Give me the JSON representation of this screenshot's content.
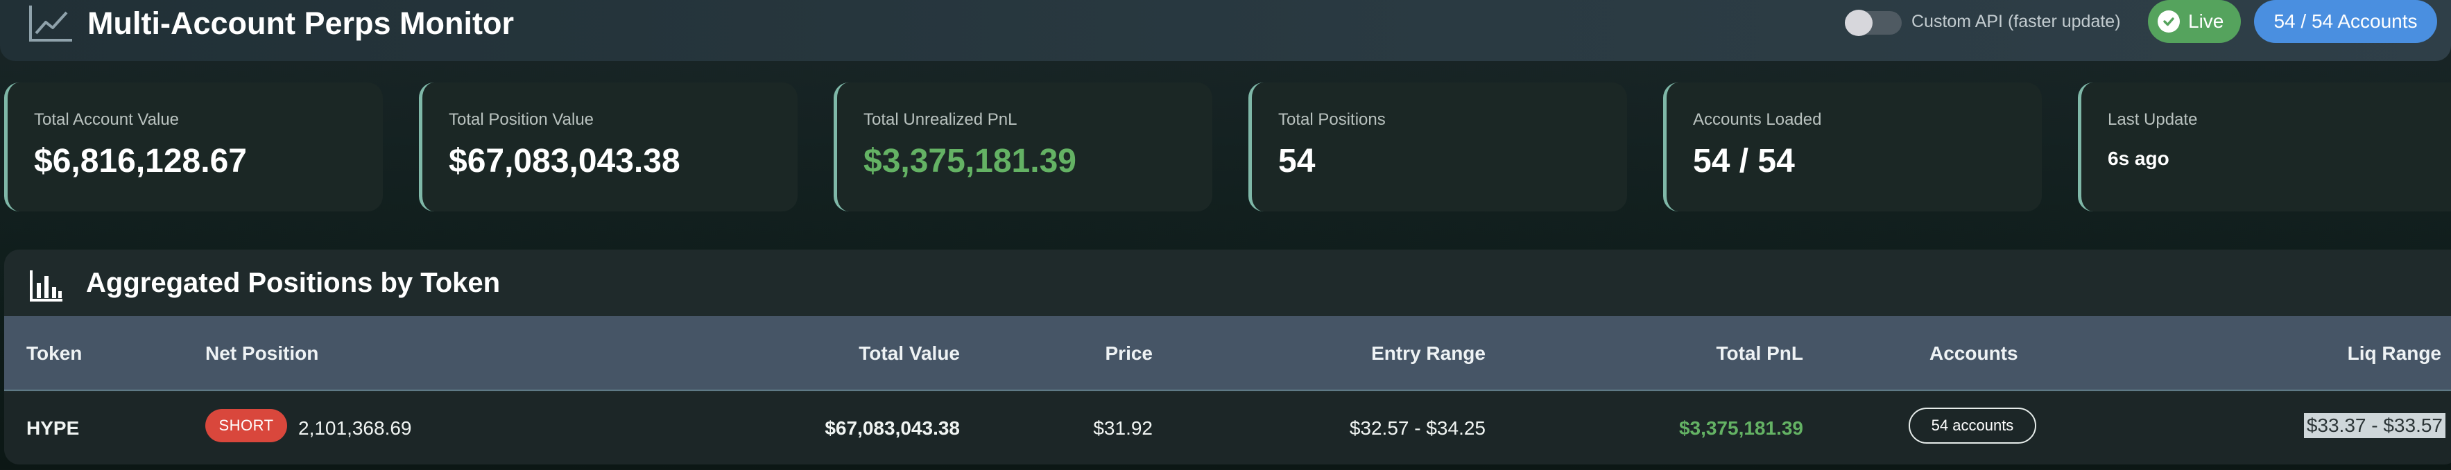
{
  "header": {
    "title": "Multi-Account Perps Monitor",
    "icon": "line-chart-icon",
    "toggle_label": "Custom API (faster update)",
    "toggle_on": false,
    "live_label": "Live",
    "accounts_label": "54 / 54 Accounts"
  },
  "colors": {
    "live": "#55a35d",
    "accounts": "#4a8fe0",
    "positive": "#64b264",
    "short": "#d9473c",
    "accent_border": "#7fb8a8"
  },
  "cards": [
    {
      "label": "Total Account Value",
      "value": "$6,816,128.67"
    },
    {
      "label": "Total Position Value",
      "value": "$67,083,043.38"
    },
    {
      "label": "Total Unrealized PnL",
      "value": "$3,375,181.39"
    },
    {
      "label": "Total Positions",
      "value": "54"
    },
    {
      "label": "Accounts Loaded",
      "value": "54 / 54"
    },
    {
      "label": "Last Update",
      "value": "6s ago"
    }
  ],
  "panel": {
    "title": "Aggregated Positions by Token",
    "icon": "bar-chart-icon",
    "columns": [
      "Token",
      "Net Position",
      "Total Value",
      "Price",
      "Entry Range",
      "Total PnL",
      "Accounts",
      "Liq Range"
    ],
    "rows": [
      {
        "token": "HYPE",
        "side": "SHORT",
        "net_position": "2,101,368.69",
        "total_value": "$67,083,043.38",
        "price": "$31.92",
        "entry_range": "$32.57 - $34.25",
        "total_pnl": "$3,375,181.39",
        "accounts": "54 accounts",
        "liq_range": "$33.37 - $33.57"
      }
    ]
  }
}
